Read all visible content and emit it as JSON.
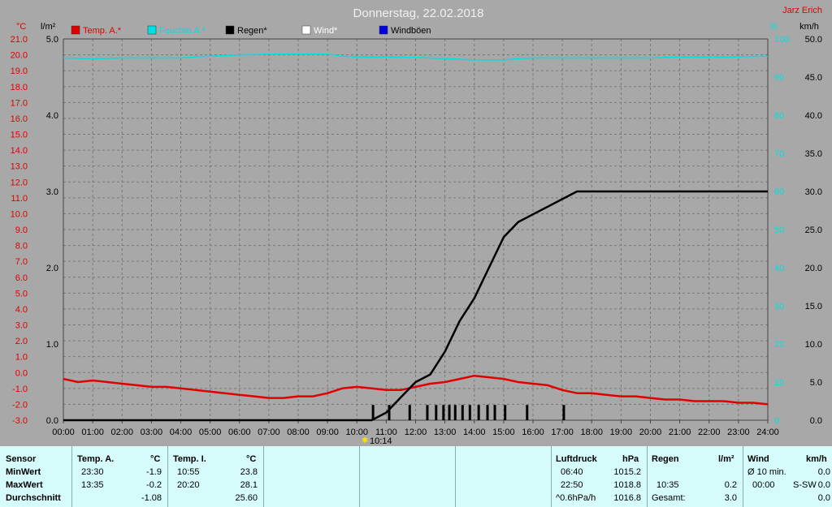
{
  "title": "Donnerstag, 22.02.2018",
  "author": "Jarz Erich",
  "units": {
    "temp": "°C",
    "rain": "l/m²",
    "humidity": "%",
    "wind": "km/h"
  },
  "legend": [
    {
      "name": "Temp. A.*",
      "color": "#e00000"
    },
    {
      "name": "Feuchte A.*",
      "color": "#00e0e0"
    },
    {
      "name": "Regen*",
      "color": "#000000"
    },
    {
      "name": "Wind*",
      "color": "#ffffff"
    },
    {
      "name": "Windböen",
      "color": "#0000e0"
    }
  ],
  "time_marker": "10:14",
  "chart_data": {
    "type": "line",
    "title": "Donnerstag, 22.02.2018",
    "x_range": [
      0,
      24
    ],
    "x_ticks": [
      "00:00",
      "01:00",
      "02:00",
      "03:00",
      "04:00",
      "05:00",
      "06:00",
      "07:00",
      "08:00",
      "09:00",
      "10:00",
      "11:00",
      "12:00",
      "13:00",
      "14:00",
      "15:00",
      "16:00",
      "17:00",
      "18:00",
      "19:00",
      "20:00",
      "21:00",
      "22:00",
      "23:00",
      "24:00"
    ],
    "y_temp_range": [
      -3.0,
      21.0
    ],
    "y_temp_ticks": [
      "21.0",
      "20.0",
      "19.0",
      "18.0",
      "17.0",
      "16.0",
      "15.0",
      "14.0",
      "13.0",
      "12.0",
      "11.0",
      "10.0",
      "9.0",
      "8.0",
      "7.0",
      "6.0",
      "5.0",
      "4.0",
      "3.0",
      "2.0",
      "1.0",
      "0.0",
      "-1.0",
      "-2.0",
      "-3.0"
    ],
    "y_rain_range": [
      0,
      5
    ],
    "y_rain_ticks": [
      "5.0",
      "4.0",
      "3.0",
      "2.0",
      "1.0",
      "0.0"
    ],
    "y_hum_range": [
      0,
      100
    ],
    "y_hum_ticks": [
      "100",
      "90",
      "80",
      "70",
      "60",
      "50",
      "40",
      "30",
      "20",
      "10",
      "0"
    ],
    "y_wind_range": [
      0,
      50
    ],
    "y_wind_ticks": [
      "50.0",
      "45.0",
      "40.0",
      "35.0",
      "30.0",
      "25.0",
      "20.0",
      "15.0",
      "10.0",
      "5.0",
      "0.0"
    ],
    "grid": true,
    "series": [
      {
        "name": "Temp. A.*",
        "color": "#e00000",
        "axis": "temp",
        "x": [
          0,
          0.25,
          0.5,
          1,
          1.5,
          2,
          2.5,
          3,
          3.5,
          4,
          4.5,
          5,
          5.5,
          6,
          6.5,
          7,
          7.5,
          8,
          8.5,
          9,
          9.5,
          10,
          10.5,
          11,
          11.5,
          12,
          12.5,
          13,
          13.5,
          14,
          14.5,
          15,
          15.5,
          16,
          16.5,
          17,
          17.5,
          18,
          18.5,
          19,
          19.5,
          20,
          20.5,
          21,
          21.5,
          22,
          22.5,
          23,
          23.5,
          24
        ],
        "values": [
          -0.4,
          -0.5,
          -0.6,
          -0.5,
          -0.6,
          -0.7,
          -0.8,
          -0.9,
          -0.9,
          -1.0,
          -1.1,
          -1.2,
          -1.3,
          -1.4,
          -1.5,
          -1.6,
          -1.6,
          -1.5,
          -1.5,
          -1.3,
          -1.0,
          -0.9,
          -1.0,
          -1.1,
          -1.1,
          -0.9,
          -0.7,
          -0.6,
          -0.4,
          -0.2,
          -0.3,
          -0.4,
          -0.6,
          -0.7,
          -0.8,
          -1.1,
          -1.3,
          -1.3,
          -1.4,
          -1.5,
          -1.5,
          -1.6,
          -1.7,
          -1.7,
          -1.8,
          -1.8,
          -1.8,
          -1.9,
          -1.9,
          -2.0
        ]
      },
      {
        "name": "Feuchte A.*",
        "color": "#00e0e0",
        "axis": "hum",
        "x": [
          0,
          1,
          2,
          3,
          4,
          4.5,
          5,
          6,
          7,
          8,
          9,
          9.5,
          10,
          11,
          12,
          13,
          14,
          15,
          15.5,
          16,
          17,
          18,
          19,
          20,
          21,
          22,
          23,
          24
        ],
        "values": [
          95.0,
          94.8,
          95.0,
          95.0,
          95.0,
          95.3,
          95.5,
          95.8,
          96.0,
          96.0,
          96.0,
          95.5,
          95.3,
          95.3,
          95.2,
          94.8,
          94.5,
          94.5,
          94.8,
          95.0,
          95.0,
          95.0,
          95.0,
          95.0,
          95.3,
          95.3,
          95.3,
          95.5
        ]
      },
      {
        "name": "Regen*",
        "color": "#000000",
        "axis": "rain",
        "x": [
          0,
          10.5,
          11,
          11.5,
          12,
          12.5,
          13,
          13.5,
          14,
          14.5,
          15,
          15.5,
          16,
          16.5,
          17,
          17.5,
          18,
          19,
          20,
          21,
          22,
          23,
          24
        ],
        "values": [
          0.0,
          0.0,
          0.1,
          0.3,
          0.5,
          0.6,
          0.9,
          1.3,
          1.6,
          2.0,
          2.4,
          2.6,
          2.7,
          2.8,
          2.9,
          3.0,
          3.0,
          3.0,
          3.0,
          3.0,
          3.0,
          3.0,
          3.0
        ]
      }
    ],
    "rain_bars_x": [
      10.55,
      11.1,
      11.8,
      12.4,
      12.7,
      12.95,
      13.15,
      13.35,
      13.6,
      13.85,
      14.15,
      14.45,
      14.7,
      15.05,
      15.8,
      17.05
    ],
    "rain_bar_height": 0.2
  },
  "summary": {
    "headers": {
      "sensor": "Sensor",
      "temp_a": "Temp. A.",
      "temp_a_unit": "°C",
      "temp_i": "Temp. I.",
      "temp_i_unit": "°C",
      "pressure": "Luftdruck",
      "pressure_unit": "hPa",
      "rain": "Regen",
      "rain_unit": "l/m²",
      "wind": "Wind",
      "wind_unit": "km/h"
    },
    "rows": [
      {
        "label": "MinWert",
        "ta_time": "23:30",
        "ta_val": "-1.9",
        "ti_time": "10:55",
        "ti_val": "23.8",
        "p_time": "06:40",
        "p_val": "1015.2",
        "r_time": "",
        "r_val": "",
        "w_label": "Ø 10 min.",
        "w_time": "",
        "w_val": "0.0"
      },
      {
        "label": "MaxWert",
        "ta_time": "13:35",
        "ta_val": "-0.2",
        "ti_time": "20:20",
        "ti_val": "28.1",
        "p_time": "22:50",
        "p_val": "1018.8",
        "r_time": "10:35",
        "r_val": "0.2",
        "w_label": "",
        "w_time": "00:00",
        "w_dir": "S-SW",
        "w_val": "0.0"
      },
      {
        "label": "Durchschnitt",
        "ta_time": "",
        "ta_val": "-1.08",
        "ti_time": "",
        "ti_val": "25.60",
        "p_time": "^0.6hPa/h",
        "p_val": "1016.8",
        "r_time": "Gesamt:",
        "r_val": "3.0",
        "w_label": "",
        "w_time": "",
        "w_val": "0.0"
      }
    ]
  }
}
